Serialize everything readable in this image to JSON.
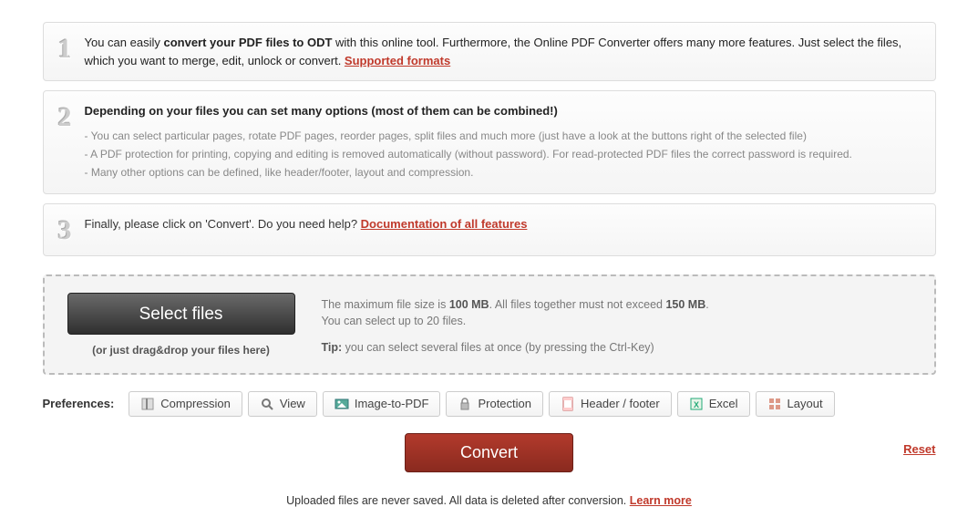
{
  "step1": {
    "text_before": "You can easily ",
    "text_bold": "convert your PDF files to ODT",
    "text_after": " with this online tool. Furthermore, the Online PDF Converter offers many more features. Just select the files, which you want to merge, edit, unlock or convert. ",
    "link": "Supported formats"
  },
  "step2": {
    "title": "Depending on your files you can set many options (most of them can be combined!)",
    "bullets": [
      "- You can select particular pages, rotate PDF pages, reorder pages, split files and much more (just have a look at the buttons right of the selected file)",
      "- A PDF protection for printing, copying and editing is removed automatically (without password). For read-protected PDF files the correct password is required.",
      "- Many other options can be defined, like header/footer, layout and compression."
    ]
  },
  "step3": {
    "text": "Finally, please click on 'Convert'. Do you need help? ",
    "link": "Documentation of all features"
  },
  "upload": {
    "button": "Select files",
    "drag_hint": "(or just drag&drop your files here)",
    "info_before_size1": "The maximum file size is ",
    "size1": "100 MB",
    "info_mid": ". All files together must not exceed ",
    "size2": "150 MB",
    "info_after": ".",
    "line2": "You can select up to 20 files.",
    "tip_label": "Tip:",
    "tip_text": " you can select several files at once (by pressing the Ctrl-Key)"
  },
  "prefs": {
    "label": "Preferences:",
    "items": [
      {
        "id": "compression",
        "label": "Compression"
      },
      {
        "id": "view",
        "label": "View"
      },
      {
        "id": "image-to-pdf",
        "label": "Image-to-PDF"
      },
      {
        "id": "protection",
        "label": "Protection"
      },
      {
        "id": "header-footer",
        "label": "Header / footer"
      },
      {
        "id": "excel",
        "label": "Excel"
      },
      {
        "id": "layout",
        "label": "Layout"
      }
    ]
  },
  "actions": {
    "convert": "Convert",
    "reset": "Reset"
  },
  "footer": {
    "text": "Uploaded files are never saved. All data is deleted after conversion. ",
    "link": "Learn more"
  }
}
